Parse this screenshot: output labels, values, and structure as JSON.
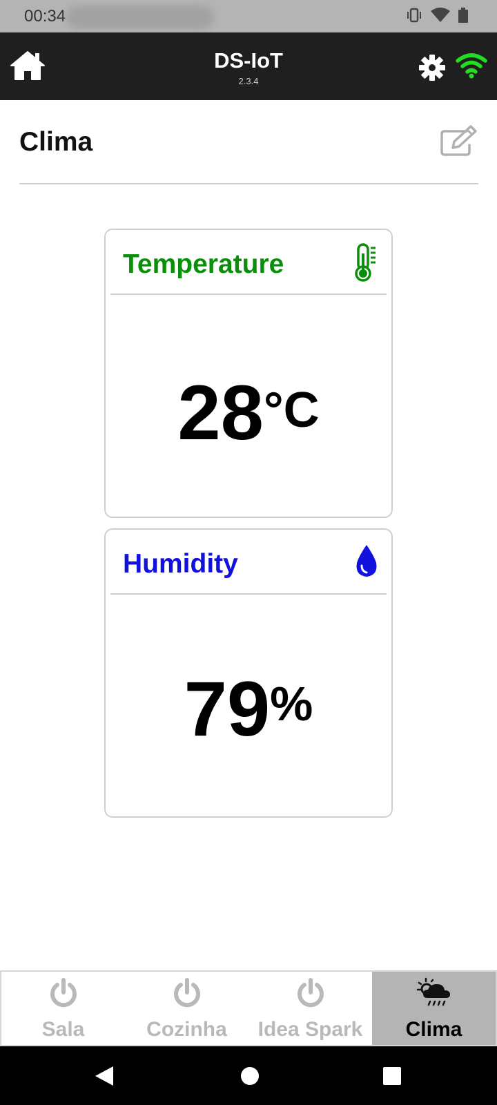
{
  "status_bar": {
    "time": "00:34"
  },
  "header": {
    "title": "DS-IoT",
    "version": "2.3.4"
  },
  "page": {
    "title": "Clima"
  },
  "cards": {
    "temperature": {
      "title": "Temperature",
      "value": "28",
      "unit": "°C",
      "color": "#0a8f0a",
      "icon": "thermometer-icon"
    },
    "humidity": {
      "title": "Humidity",
      "value": "79",
      "unit": "%",
      "color": "#1111dd",
      "icon": "water-drop-icon"
    }
  },
  "bottom_nav": {
    "tabs": [
      {
        "label": "Sala",
        "icon": "power-icon"
      },
      {
        "label": "Cozinha",
        "icon": "power-icon"
      },
      {
        "label": "Idea Spark",
        "icon": "power-icon"
      },
      {
        "label": "Clima",
        "icon": "weather-icon",
        "active": true
      }
    ]
  },
  "colors": {
    "header_bg": "#1f1f1f",
    "wifi": "#22dd22",
    "active_tab_bg": "#b4b4b4"
  }
}
